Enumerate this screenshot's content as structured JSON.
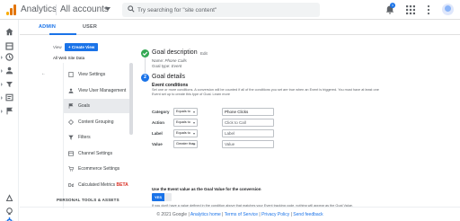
{
  "topbar": {
    "app_title": "Analytics",
    "account_selector": "All accounts",
    "search_placeholder": "Try searching for \"site content\"",
    "notification_count": "1"
  },
  "tabs": [
    {
      "label": "ADMIN",
      "active": true
    },
    {
      "label": "USER",
      "active": false
    }
  ],
  "view": {
    "label": "View",
    "create_button": "+ Create View",
    "name": "All Web Site Data"
  },
  "nav": {
    "items": [
      {
        "label": "View Settings",
        "icon": "document-icon"
      },
      {
        "label": "View User Management",
        "icon": "users-icon"
      },
      {
        "label": "Goals",
        "icon": "flag-icon",
        "active": true
      },
      {
        "label": "Content Grouping",
        "icon": "content-icon"
      },
      {
        "label": "Filters",
        "icon": "filter-icon"
      },
      {
        "label": "Channel Settings",
        "icon": "channel-icon"
      },
      {
        "label": "Ecommerce Settings",
        "icon": "cart-icon"
      },
      {
        "label": "Calculated Metrics",
        "badge": "BETA",
        "icon": "dd-icon"
      }
    ],
    "section_label": "PERSONAL TOOLS & ASSETS"
  },
  "goal": {
    "description_title": "Goal description",
    "edit_label": "Edit",
    "name_line_label": "Name:",
    "name_value": "Phone Calls",
    "type_line_label": "Goal type:",
    "type_value": "Event",
    "step_number": "2",
    "details_title": "Goal details",
    "conditions_title": "Event conditions",
    "conditions_help": "Set one or more conditions. A conversion will be counted if all of the conditions you set are true when an Event is triggered. You must have at least one Event set up to create this type of Goal. Learn more",
    "conditions": [
      {
        "label": "Category",
        "operator": "Equals to",
        "value": "Phone Clicks",
        "placeholder": ""
      },
      {
        "label": "Action",
        "operator": "Equals to",
        "value": "",
        "placeholder": "Click to Call"
      },
      {
        "label": "Label",
        "operator": "Equals to",
        "value": "",
        "placeholder": "Label"
      },
      {
        "label": "Value",
        "operator": "Greater than",
        "value": "",
        "placeholder": "Value"
      }
    ],
    "event_value_title": "Use the Event value as the Goal Value for the conversion",
    "toggle_yes": "YES",
    "event_value_help": "If you don't have a value defined in the condition above that matches your Event tracking code, nothing will appear as the Goal Value."
  },
  "footer": {
    "copyright": "© 2021 Google |",
    "links": [
      "Analytics home",
      "Terms of Service",
      "Privacy Policy",
      "Send feedback"
    ]
  },
  "colors": {
    "accent": "#1a73e8",
    "success": "#34a853",
    "logo_orange": "#e37400",
    "logo_yellow": "#f9ab00"
  }
}
